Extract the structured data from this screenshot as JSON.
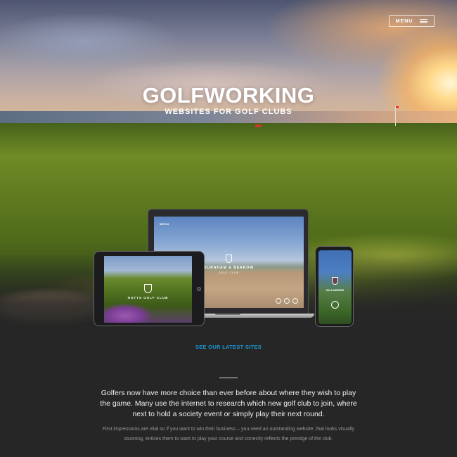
{
  "header": {
    "menu_label": "MENU"
  },
  "hero": {
    "title": "GOLFWORKING",
    "subtitle": "WEBSITES FOR GOLF CLUBS"
  },
  "devices": {
    "laptop": {
      "nav_label": "MENU",
      "club_name": "BURNHAM & BERROW",
      "club_sub": "GOLF CLUB"
    },
    "tablet": {
      "club_name": "NOTTS GOLF CLUB"
    },
    "phone": {
      "club_name": "HALLAMSHIRE"
    }
  },
  "cta": {
    "latest_sites": "SEE OUR LATEST SITES"
  },
  "intro": {
    "lead": "Golfers now have more choice than ever before about where they wish to play the game. Many use the internet to research which new golf club to join, where next to hold a society event or simply play their next round.",
    "body": "First impressions are vital so if you want to win their business – you need an outstanding website, that looks visually stunning, entices them to want to play your course and correctly reflects the prestige of the club."
  },
  "colors": {
    "accent": "#1a9ad6",
    "background": "#262626"
  }
}
